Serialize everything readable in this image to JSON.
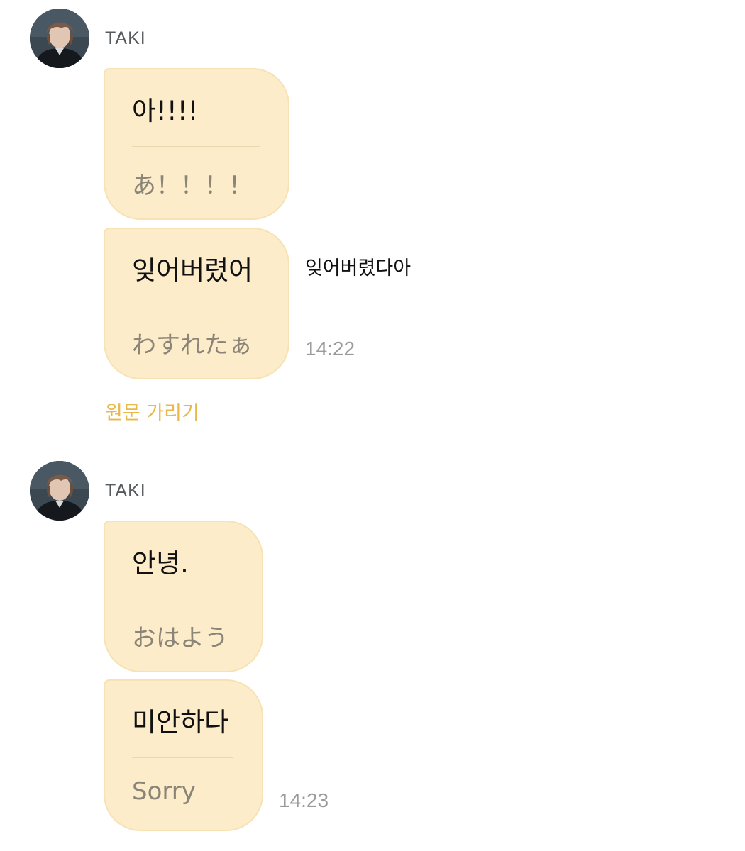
{
  "groups": [
    {
      "sender": "TAKI",
      "messages": [
        {
          "original": "아!!!!",
          "translated": "あ！！！！"
        },
        {
          "original": "잊어버렸어",
          "translated": "わすれたぁ",
          "side_note": "잊어버렸다아",
          "time": "14:22"
        }
      ],
      "hide_original_label": "원문 가리기"
    },
    {
      "sender": "TAKI",
      "messages": [
        {
          "original": "안녕.",
          "translated": "おはよう"
        },
        {
          "original": "미안하다",
          "translated": "Sorry",
          "time": "14:23"
        }
      ]
    }
  ],
  "colors": {
    "bubble_bg": "#fcecc9",
    "bubble_border": "#f6e2b4",
    "link": "#e8b84a",
    "timestamp": "#9a9a9a"
  },
  "icons": {
    "avatar": "profile-photo"
  }
}
